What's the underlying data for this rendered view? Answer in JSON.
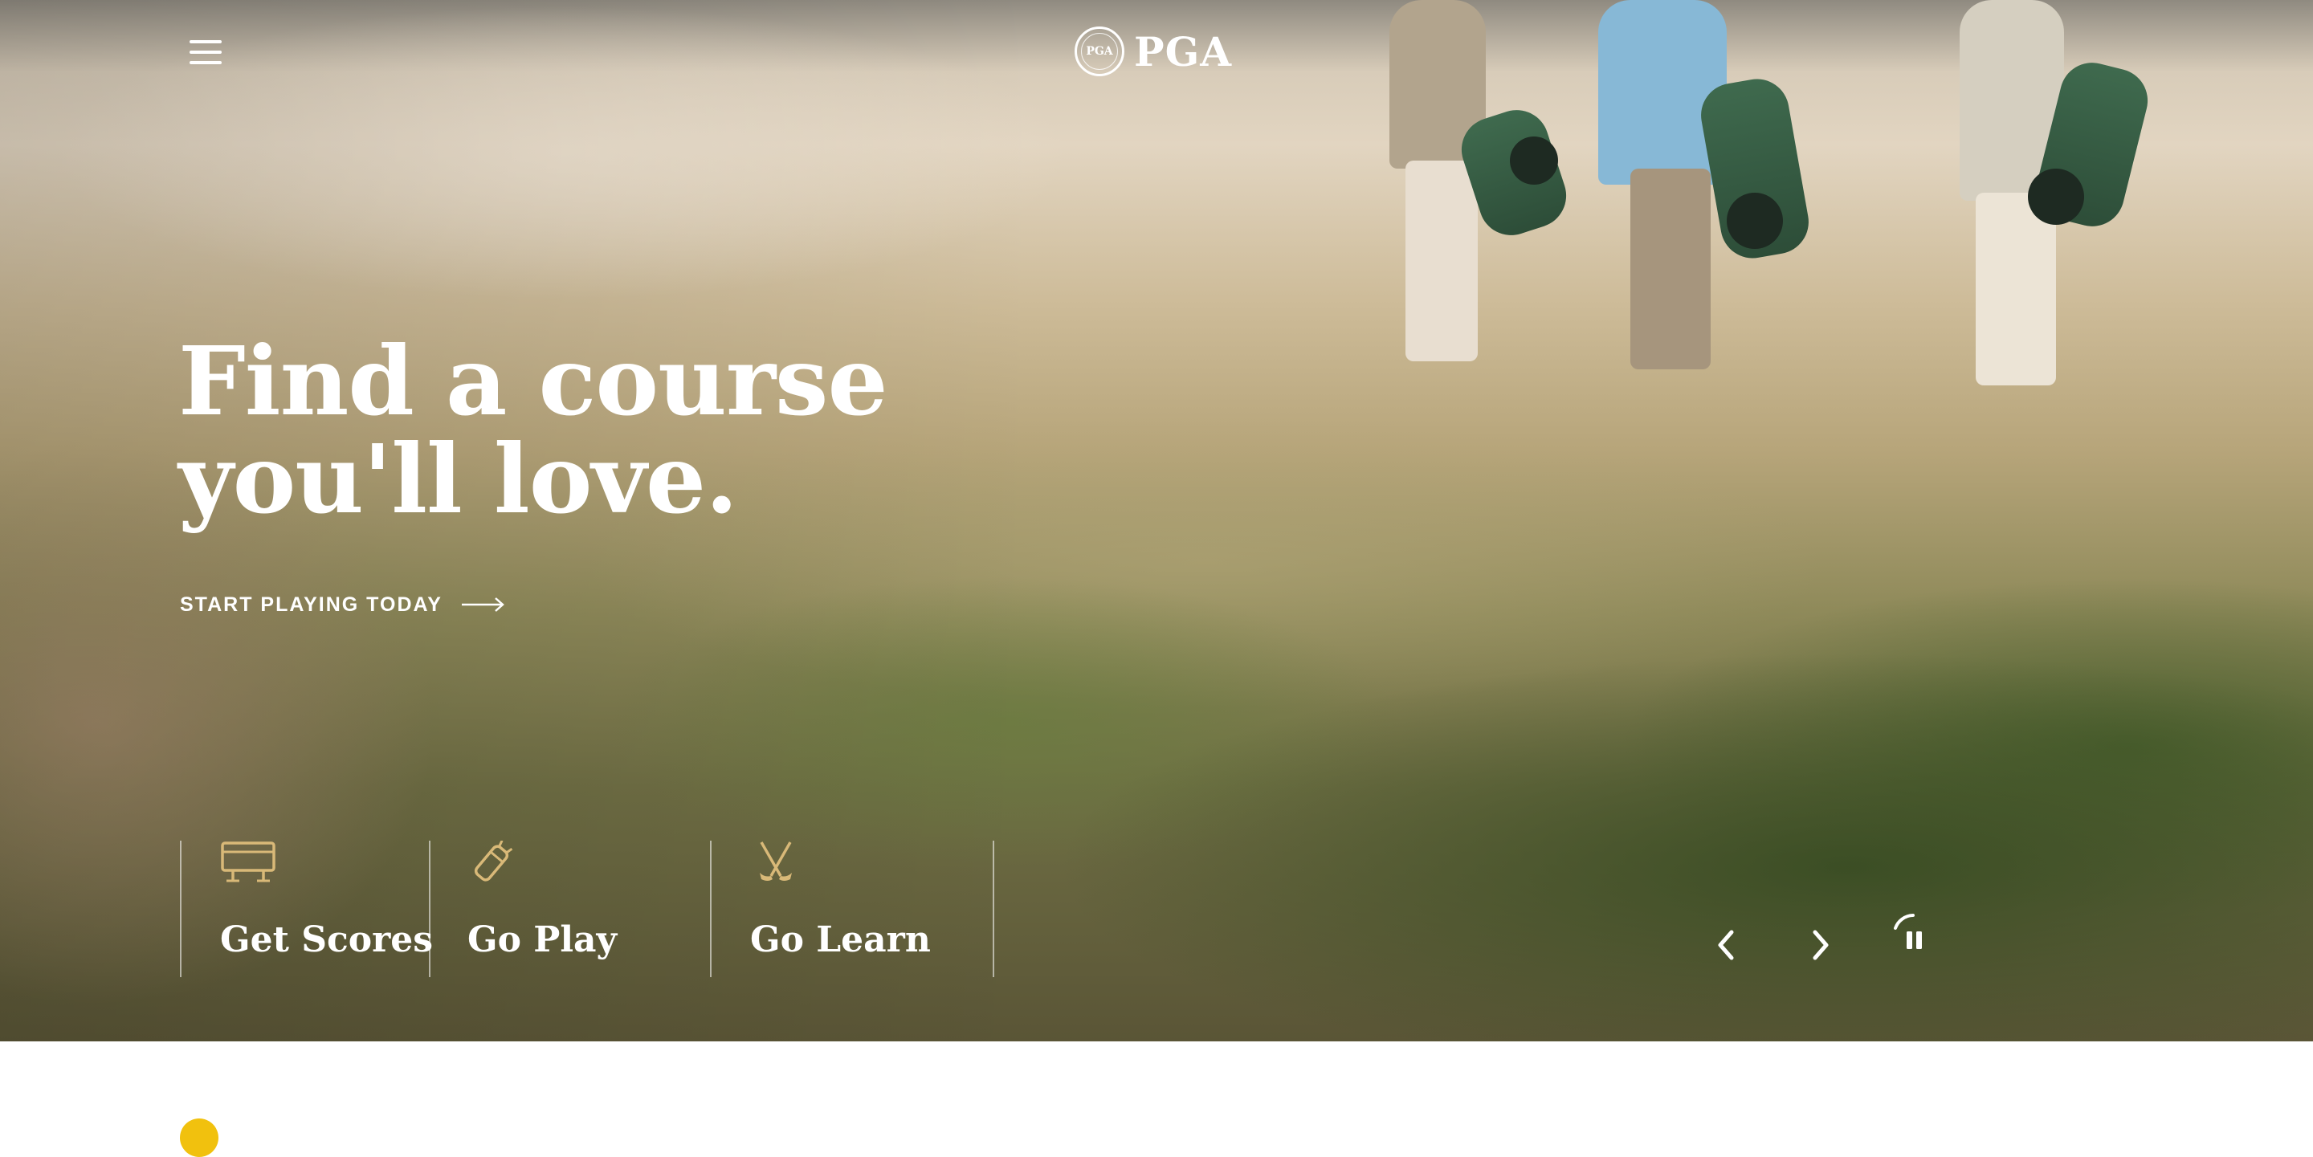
{
  "header": {
    "menu_icon": "hamburger-menu-icon",
    "logo_text": "PGA",
    "logo_seal_text": "PGA"
  },
  "hero": {
    "headline": "Find a course you'll love.",
    "cta_label": "START PLAYING TODAY",
    "cta_icon": "long-arrow-right-icon"
  },
  "quick_links": [
    {
      "label": "Get Scores",
      "icon": "scoreboard-icon"
    },
    {
      "label": "Go Play",
      "icon": "golf-bag-icon"
    },
    {
      "label": "Go Learn",
      "icon": "crossed-clubs-icon"
    }
  ],
  "carousel": {
    "prev_icon": "chevron-left-icon",
    "next_icon": "chevron-right-icon",
    "pause_icon": "pause-icon"
  },
  "colors": {
    "accent_gold": "#d9b978",
    "text_white": "#ffffff",
    "badge_yellow": "#f1c10e"
  }
}
